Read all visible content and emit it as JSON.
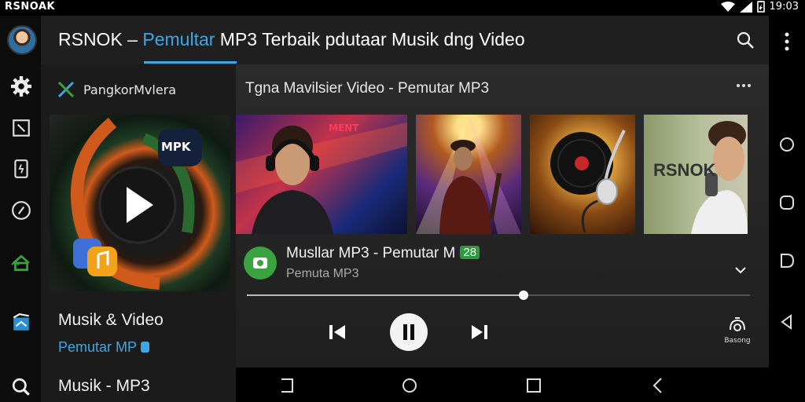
{
  "status_bar": {
    "carrier": "RSNOAK",
    "clock": "19:03"
  },
  "header": {
    "title_part1": "RSNOK – ",
    "title_accent": "Pemultar",
    "title_part2": " MP3 Terbaik pdutaar Musik dng Video"
  },
  "drawer": {
    "heading": "PangkorMvlera",
    "art_label": "MPK",
    "item1": "Musik & Video",
    "item2": "Pemutar MP",
    "item3": "Musik - MP3"
  },
  "section": {
    "title": "Tgna Mavilsier Video - Pemutar MP3"
  },
  "thumbnails": [
    {
      "text": "MENT"
    },
    {
      "text": ""
    },
    {
      "text": ""
    },
    {
      "text": "RSNOK"
    }
  ],
  "now_playing": {
    "title": "Musllar MP3 - Pemutar M",
    "badge": "28",
    "subtitle": "Pemuta MP3",
    "progress": 0.55
  },
  "controls": {
    "cast_label": "Basong"
  },
  "colors": {
    "accent": "#3da7e6",
    "green": "#3aa23f",
    "orange": "#d05a1c"
  }
}
